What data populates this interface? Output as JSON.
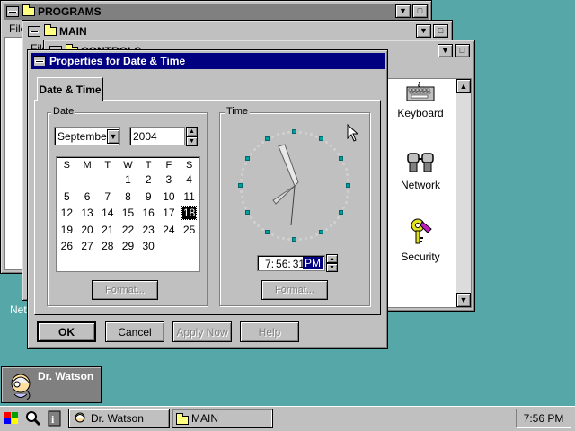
{
  "desktop": {
    "programs_window": {
      "title": "PROGRAMS",
      "menu_partial": "File"
    },
    "main_window": {
      "title": "MAIN",
      "menu_partial": "File"
    },
    "controls_window": {
      "title": "CONTROLS",
      "icons": [
        {
          "label": "Keyboard",
          "icon": "keyboard-icon"
        },
        {
          "label": "Network",
          "icon": "network-icon"
        },
        {
          "label": "Security",
          "icon": "key-icon"
        }
      ],
      "partial_left_label": "Netw"
    },
    "minimized_app": {
      "label": "Dr. Watson"
    }
  },
  "dialog": {
    "title": "Properties for Date & Time",
    "tab": "Date & Time",
    "date_group": {
      "label": "Date",
      "month": "September",
      "year": "2004",
      "weekdays": [
        "S",
        "M",
        "T",
        "W",
        "T",
        "F",
        "S"
      ],
      "weeks": [
        [
          "",
          "",
          "",
          "1",
          "2",
          "3",
          "4"
        ],
        [
          "5",
          "6",
          "7",
          "8",
          "9",
          "10",
          "11"
        ],
        [
          "12",
          "13",
          "14",
          "15",
          "16",
          "17",
          "18"
        ],
        [
          "19",
          "20",
          "21",
          "22",
          "23",
          "24",
          "25"
        ],
        [
          "26",
          "27",
          "28",
          "29",
          "30",
          "",
          ""
        ]
      ],
      "selected_day": "18",
      "format_button": "Format..."
    },
    "time_group": {
      "label": "Time",
      "hour": "7",
      "minute": "56",
      "second": "31",
      "ampm": "PM",
      "format_button": "Format..."
    },
    "buttons": {
      "ok": "OK",
      "cancel": "Cancel",
      "apply": "Apply Now",
      "help": "Help"
    }
  },
  "taskbar": {
    "tasks": [
      {
        "label": "Dr. Watson"
      },
      {
        "label": "MAIN"
      }
    ],
    "clock": "7:56 PM"
  }
}
